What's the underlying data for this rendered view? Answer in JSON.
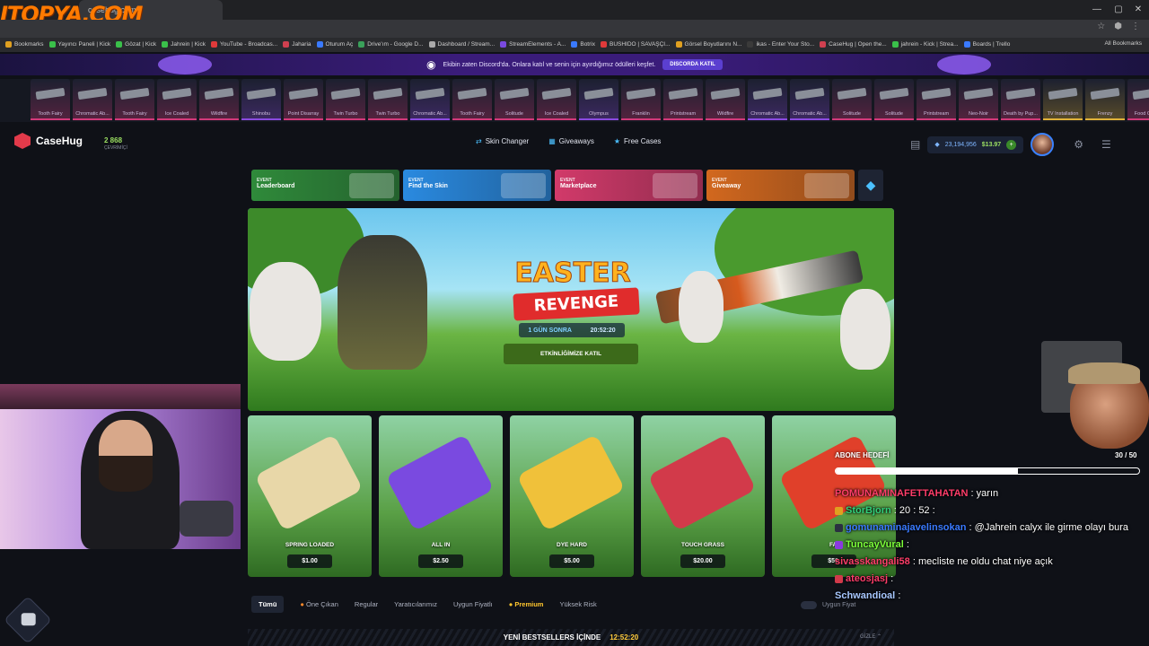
{
  "watermark": "ITOPYA.COM",
  "browser": {
    "tab_title": "casehug.com",
    "bookmarks": [
      "Bookmarks",
      "Yayıncı Paneli | Kick",
      "Gözat | Kick",
      "Jahrein | Kick",
      "YouTube - Broadcas...",
      "Jaharia",
      "Oturum Aç",
      "Drive'ım - Google D...",
      "Dashboard / Stream...",
      "StreamElements - A...",
      "Botrix",
      "BUSHIDO | SAVAŞÇI...",
      "Görsel Boyutlarını N...",
      "ikas - Enter Your Sto...",
      "CaseHug | Open the...",
      "jahrein - Kick | Strea...",
      "Boards | Trello"
    ],
    "all_bookmarks": "All Bookmarks"
  },
  "discord_banner": {
    "text": "Ekibin zaten Discord'da. Onlara katıl ve senin için ayırdığımız ödülleri keşfet.",
    "button": "DISCORDA KATIL"
  },
  "live_drops": [
    {
      "name": "Tooth Fairy",
      "color": "#d23a7a"
    },
    {
      "name": "Chromatic Ab...",
      "color": "#d23a7a"
    },
    {
      "name": "Tooth Fairy",
      "color": "#d23a7a"
    },
    {
      "name": "Ice Coaled",
      "color": "#d23a7a"
    },
    {
      "name": "Wildfire",
      "color": "#d23a7a"
    },
    {
      "name": "Shinobu",
      "color": "#8a4ae0"
    },
    {
      "name": "Point Disarray",
      "color": "#d23a7a"
    },
    {
      "name": "Twin Turbo",
      "color": "#d23a7a"
    },
    {
      "name": "Twin Turbo",
      "color": "#d23a7a"
    },
    {
      "name": "Chromatic Ab...",
      "color": "#8a4ae0"
    },
    {
      "name": "Tooth Fairy",
      "color": "#d23a7a"
    },
    {
      "name": "Solitude",
      "color": "#d23a7a"
    },
    {
      "name": "Ice Coaled",
      "color": "#d23a7a"
    },
    {
      "name": "Olympus",
      "color": "#8a4ae0"
    },
    {
      "name": "Franklin",
      "color": "#d23a7a"
    },
    {
      "name": "Printstream",
      "color": "#d23a7a"
    },
    {
      "name": "Wildfire",
      "color": "#d23a7a"
    },
    {
      "name": "Chromatic Ab...",
      "color": "#8a4ae0"
    },
    {
      "name": "Chromatic Ab...",
      "color": "#8a4ae0"
    },
    {
      "name": "Solitude",
      "color": "#d23a7a"
    },
    {
      "name": "Solitude",
      "color": "#d23a7a"
    },
    {
      "name": "Printstream",
      "color": "#d23a7a"
    },
    {
      "name": "Neo-Noir",
      "color": "#d23a7a"
    },
    {
      "name": "Death by Pup...",
      "color": "#d23a7a"
    },
    {
      "name": "TV Installation",
      "color": "#e0b23a"
    },
    {
      "name": "Frenzy",
      "color": "#e0b23a"
    },
    {
      "name": "Food Chain",
      "color": "#d23a7a"
    }
  ],
  "header": {
    "brand": "CaseHug",
    "online_count": "2 868",
    "online_label": "ÇEVRİMİÇİ",
    "nav": [
      {
        "label": "Skin Changer",
        "icon": "swap-icon",
        "glyph": "⇄"
      },
      {
        "label": "Giveaways",
        "icon": "gift-icon",
        "glyph": "▦"
      },
      {
        "label": "Free Cases",
        "icon": "star-icon",
        "glyph": "★"
      }
    ],
    "coins": "23,194,956",
    "cash": "$13.97"
  },
  "events": [
    {
      "tag": "EVENT",
      "title": "Leaderboard",
      "color": "#2f8a3a"
    },
    {
      "tag": "EVENT",
      "title": "Find the Skin",
      "color": "#2a8ae0"
    },
    {
      "tag": "EVENT",
      "title": "Marketplace",
      "color": "#d23a6a"
    },
    {
      "tag": "EVENT",
      "title": "Giveaway",
      "color": "#d2681e"
    }
  ],
  "hero": {
    "title": "EASTER",
    "subtitle": "REVENGE",
    "timer_label": "1 GÜN SONRA",
    "timer_value": "20:52:20",
    "cta": "ETKİNLİĞİMİZE KATIL"
  },
  "cases": [
    {
      "name": "SPRING LOADED",
      "price": "$1.00",
      "item_color": "#e8d7a8"
    },
    {
      "name": "ALL IN",
      "price": "$2.50",
      "item_color": "#7a4ae0"
    },
    {
      "name": "DYE HARD",
      "price": "$5.00",
      "item_color": "#f0c13a"
    },
    {
      "name": "TOUCH GRASS",
      "price": "$20.00",
      "item_color": "#d23a4a"
    },
    {
      "name": "FAI",
      "price": "$50.",
      "item_color": "#e0402a"
    }
  ],
  "filters": {
    "tabs": [
      "Tümü",
      "Öne Çıkan",
      "Regular",
      "Yaratıcılarımız",
      "Uygun Fiyatlı",
      "Premium",
      "Yüksek Risk"
    ],
    "toggle_label": "Uygun Fiyat"
  },
  "bestsellers": {
    "label": "YENİ BESTSELLERS İÇİNDE",
    "time": "12:52:20",
    "hide": "GİZLE"
  },
  "subgoal": {
    "label": "ABONE HEDEFİ",
    "count": "30 / 50",
    "progress": 0.6
  },
  "chat": [
    {
      "user": "POMUNAMINAFETTAHATAN",
      "user_color": "#ff3d6a",
      "badge": "",
      "text": ": yarın"
    },
    {
      "user": "StorBjorn",
      "user_color": "#31d07a",
      "badge": "#e0a020",
      "text": ": 20 : 52 :"
    },
    {
      "user": "gomunaminajavelinsokan",
      "user_color": "#3a7aff",
      "badge": "#2a3040",
      "text": ": @Jahrein calyx ile girme olayı bura"
    },
    {
      "user": "TuncayVural",
      "user_color": "#7cff3a",
      "badge": "#8a3ae0",
      "text": ":"
    },
    {
      "user": "sivasskangali58",
      "user_color": "#ff3d6a",
      "badge": "",
      "text": ": mecliste ne oldu chat niye açık"
    },
    {
      "user": "ateosjasj",
      "user_color": "#ff3d6a",
      "badge": "#d23a4a",
      "text": ":"
    },
    {
      "user": "Schwandioal",
      "user_color": "#a8c8ff",
      "badge": "",
      "text": ":"
    }
  ]
}
